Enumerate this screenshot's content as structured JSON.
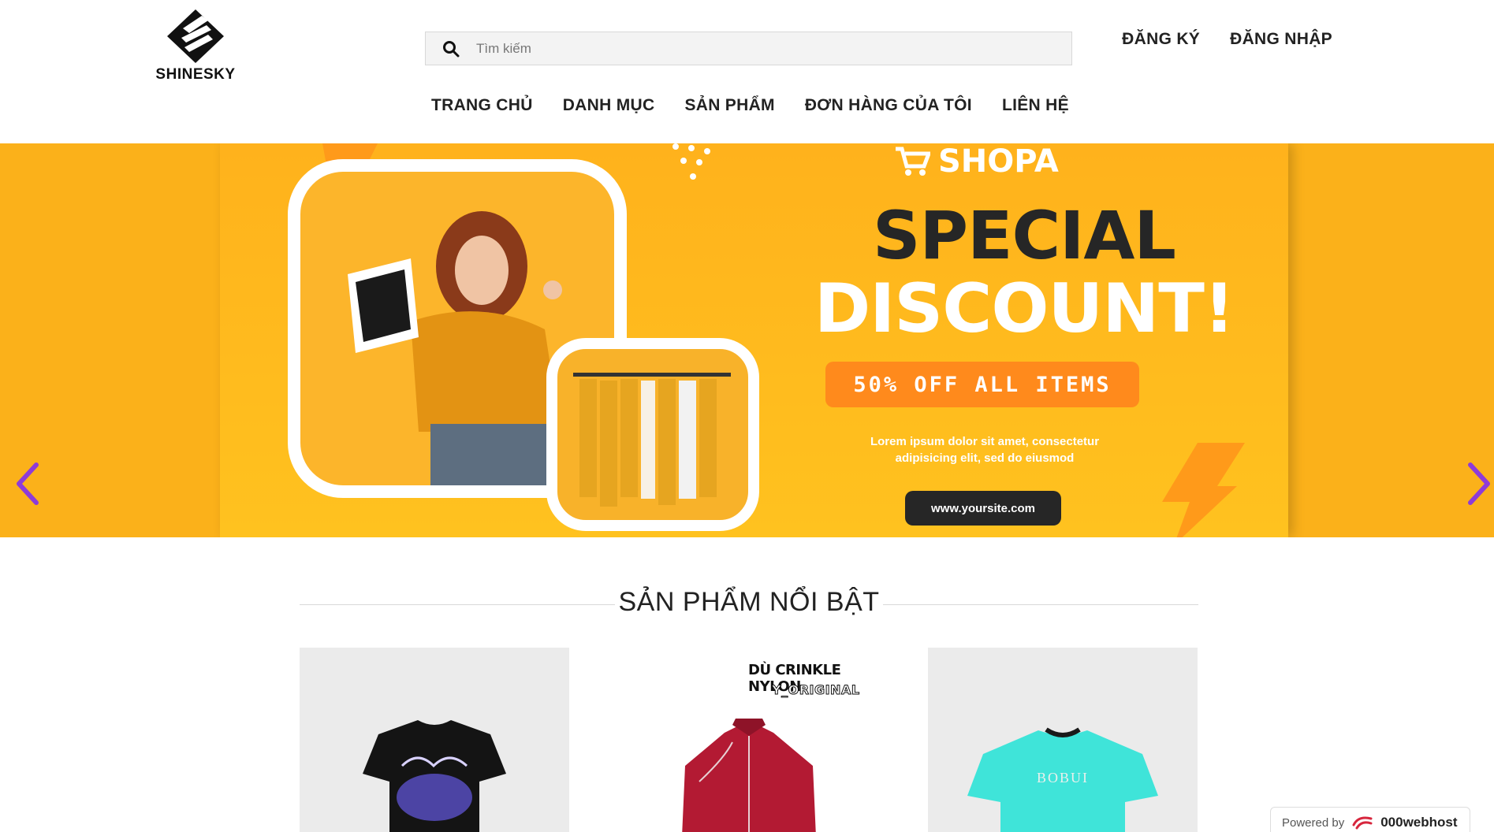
{
  "header": {
    "logo_text": "SHINESKY",
    "search": {
      "placeholder": "Tìm kiếm",
      "value": ""
    },
    "auth": {
      "register": "ĐĂNG KÝ",
      "login": "ĐĂNG NHẬP"
    },
    "nav": [
      {
        "label": "TRANG CHỦ"
      },
      {
        "label": "DANH MỤC"
      },
      {
        "label": "SẢN PHẨM"
      },
      {
        "label": "ĐƠN HÀNG CỦA TÔI"
      },
      {
        "label": "LIÊN HỆ"
      }
    ]
  },
  "banner": {
    "brand": "SHOPA",
    "headline1": "SPECIAL",
    "headline2": "DISCOUNT!",
    "offer": "50% OFF ALL ITEMS",
    "body_line1": "Lorem ipsum dolor sit amet, consectetur",
    "body_line2": "adipisicing elit, sed do eiusmod",
    "site": "www.yoursite.com"
  },
  "section": {
    "title": "SẢN PHẨM NỔI BẬT"
  },
  "products": [
    {
      "caption": ""
    },
    {
      "caption_line1": "DÙ CRINKLE NYLON",
      "caption_line2": "Y_ORIGINAL"
    },
    {
      "brand_print": "BOBUI"
    }
  ],
  "footer_badge": {
    "prefix": "Powered by",
    "name": "000webhost"
  },
  "colors": {
    "banner_bg": "#fbb11a",
    "offer_bg": "#ff8a1c",
    "arrow": "#8e3bd8",
    "tee_teal": "#3fe4d9",
    "jacket_red": "#b31a33"
  }
}
